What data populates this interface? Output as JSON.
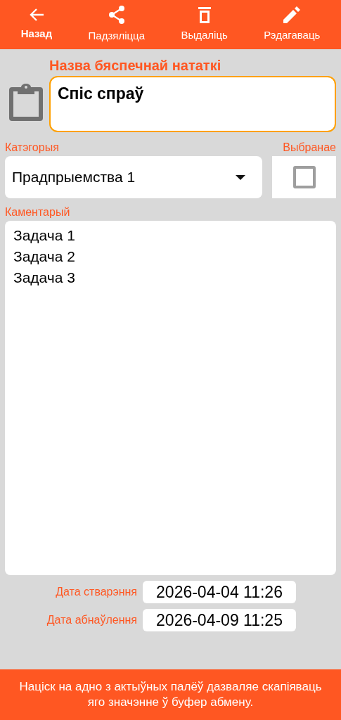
{
  "toolbar": [
    {
      "kind": "back",
      "label": "Назад",
      "selected": true
    },
    {
      "kind": "share",
      "label": "Падзяліцца",
      "selected": false
    },
    {
      "kind": "delete",
      "label": "Выдаліць",
      "selected": false
    },
    {
      "kind": "edit",
      "label": "Рэдагаваць",
      "selected": false
    }
  ],
  "title_field": {
    "label": "Назва бяспечнай нататкі",
    "value": "Спіс спраў"
  },
  "category": {
    "label": "Катэгорыя",
    "value": "Прадпрыемства 1"
  },
  "favorite": {
    "label": "Выбранае",
    "checked": false
  },
  "comment": {
    "label": "Каментарый",
    "value": "Задача 1\nЗадача 2\nЗадача 3"
  },
  "dates": [
    {
      "label": "Дата стварэння",
      "value": "2026-04-04 11:26"
    },
    {
      "label": "Дата абнаўлення",
      "value": "2026-04-09 11:25"
    }
  ],
  "footer": {
    "text": "Націск на адно з актыўных палёў дазваляе скапіяваць яго значэнне ў буфер абмену."
  }
}
